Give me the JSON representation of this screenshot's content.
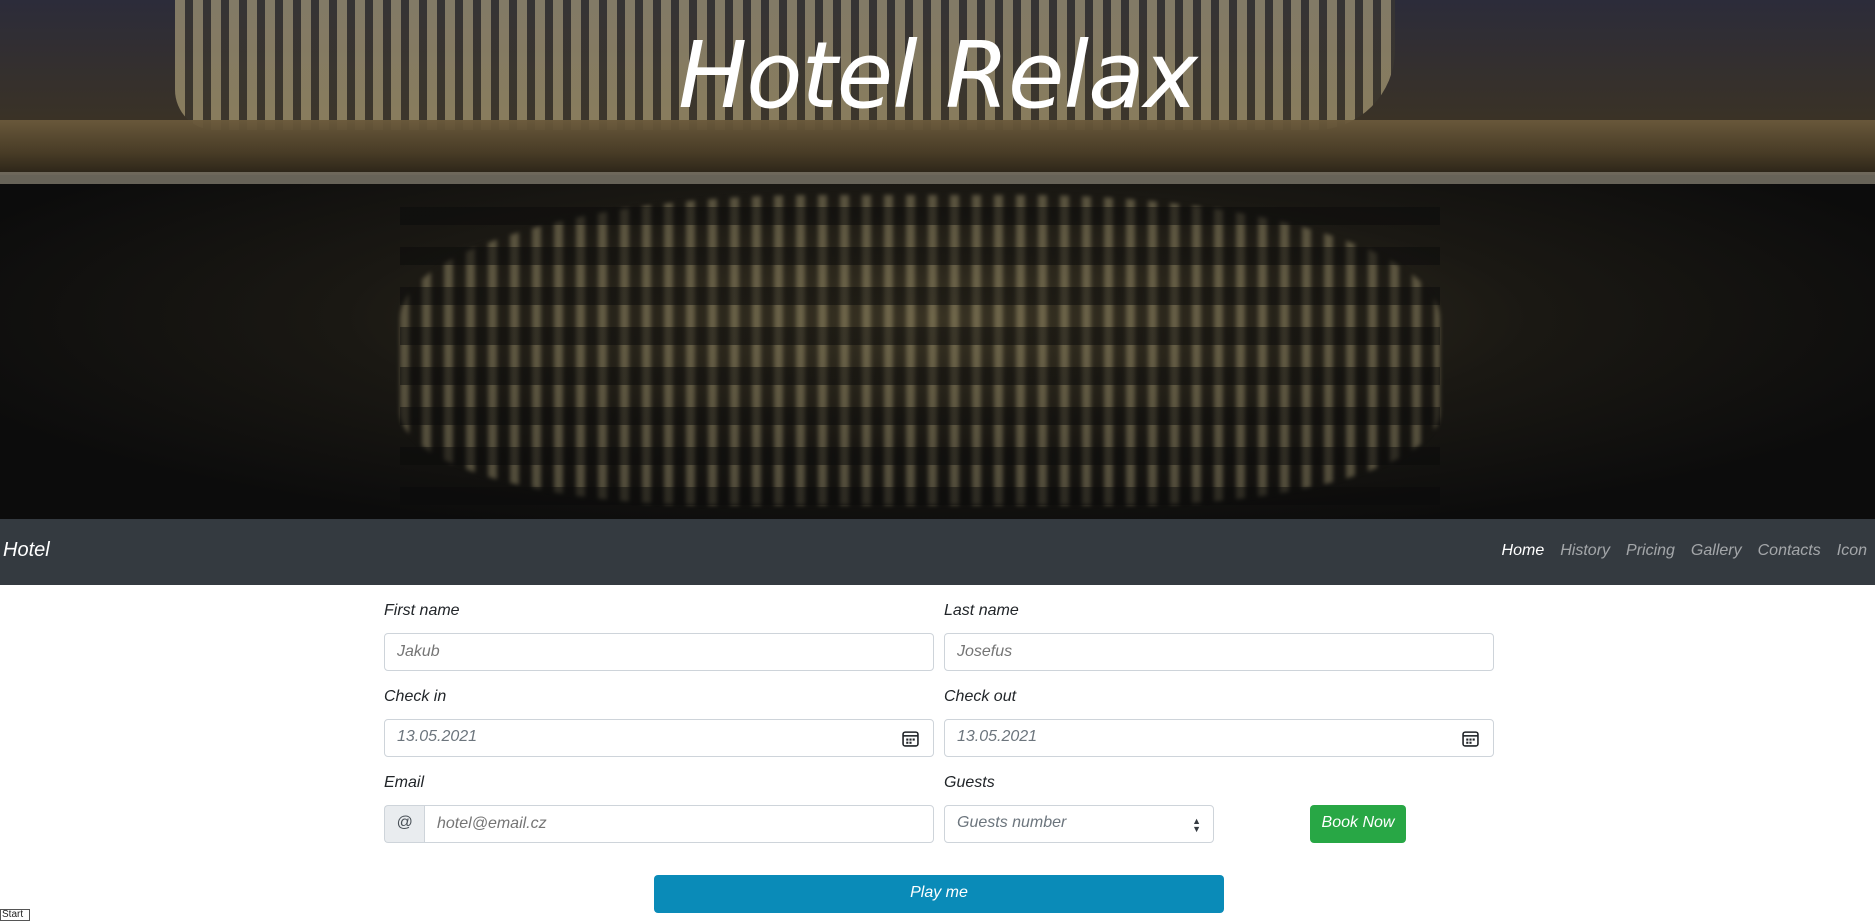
{
  "hero": {
    "title": "Hotel Relax"
  },
  "navbar": {
    "brand": "Hotel",
    "items": [
      {
        "label": "Home",
        "active": true
      },
      {
        "label": "History",
        "active": false
      },
      {
        "label": "Pricing",
        "active": false
      },
      {
        "label": "Gallery",
        "active": false
      },
      {
        "label": "Contacts",
        "active": false
      },
      {
        "label": "Icon",
        "active": false
      }
    ]
  },
  "form": {
    "first_name": {
      "label": "First name",
      "placeholder": "Jakub"
    },
    "last_name": {
      "label": "Last name",
      "placeholder": "Josefus"
    },
    "check_in": {
      "label": "Check in",
      "value": "13.05.2021"
    },
    "check_out": {
      "label": "Check out",
      "value": "13.05.2021"
    },
    "email": {
      "label": "Email",
      "addon": "@",
      "placeholder": "hotel@email.cz"
    },
    "guests": {
      "label": "Guests",
      "selected": "Guests number"
    },
    "book_button": "Book Now",
    "play_button": "Play me"
  },
  "footer": {
    "start_label": "Start"
  },
  "colors": {
    "navbar_bg": "#343a40",
    "book_button": "#28a745",
    "play_button": "#0a8bb8"
  },
  "icons": [
    "calendar-icon",
    "chevron-updown-icon"
  ]
}
